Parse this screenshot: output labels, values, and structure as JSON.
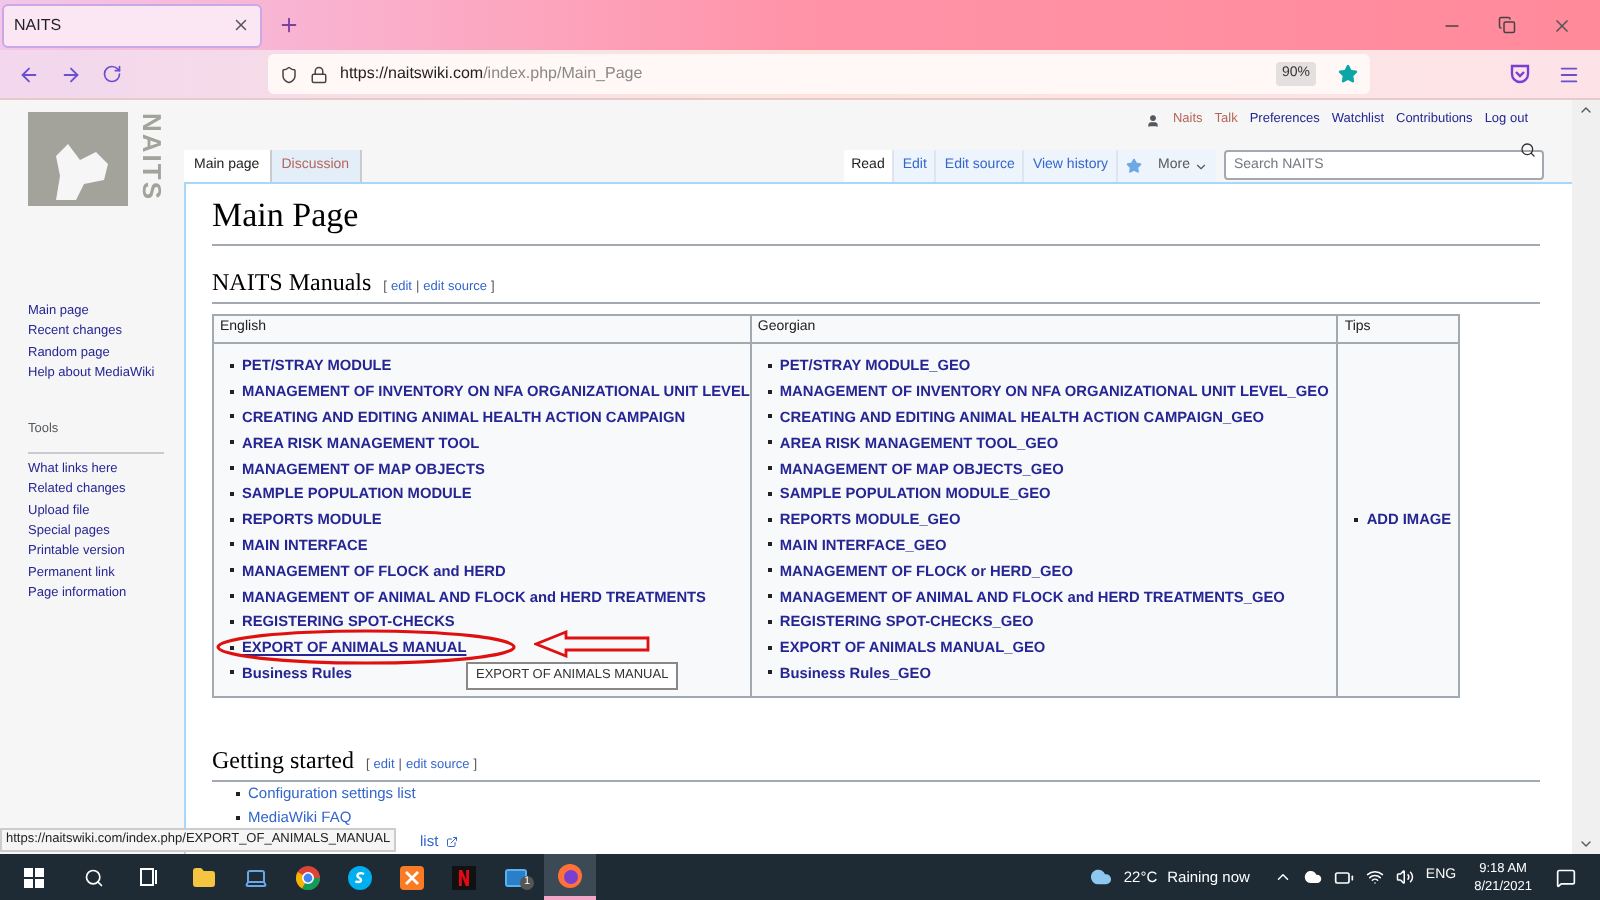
{
  "browser": {
    "tab_title": "NAITS",
    "url_host": "https://naitswiki.com",
    "url_path": "/index.php/Main_Page",
    "zoom": "90%"
  },
  "logo_text": "NAITS",
  "personal_links": [
    {
      "label": "Naits",
      "missing": true
    },
    {
      "label": "Talk",
      "missing": true
    },
    {
      "label": "Preferences",
      "missing": false
    },
    {
      "label": "Watchlist",
      "missing": false
    },
    {
      "label": "Contributions",
      "missing": false
    },
    {
      "label": "Log out",
      "missing": false
    }
  ],
  "namespace_tabs": [
    {
      "label": "Main page",
      "selected": true,
      "missing": false
    },
    {
      "label": "Discussion",
      "selected": false,
      "missing": true
    }
  ],
  "view_tabs": [
    {
      "label": "Read",
      "selected": true
    },
    {
      "label": "Edit",
      "selected": false
    },
    {
      "label": "Edit source",
      "selected": false
    },
    {
      "label": "View history",
      "selected": false
    }
  ],
  "more_menu": "More",
  "search": {
    "placeholder": "Search NAITS"
  },
  "sidebar": {
    "navigation": [
      "Main page",
      "Recent changes",
      "Random page",
      "Help about MediaWiki"
    ],
    "tools_heading": "Tools",
    "tools": [
      "What links here",
      "Related changes",
      "Upload file",
      "Special pages",
      "Printable version",
      "Permanent link",
      "Page information"
    ]
  },
  "page_title": "Main Page",
  "manuals_section": {
    "title": "NAITS Manuals",
    "edit_links": {
      "open": "[",
      "links": [
        "edit",
        "edit source"
      ],
      "separator": "|",
      "close": "]"
    },
    "table": {
      "columns": [
        "English",
        "Georgian",
        "Tips"
      ],
      "english": [
        {
          "label": "PET/STRAY MODULE",
          "hovered": false
        },
        {
          "label": "MANAGEMENT OF INVENTORY ON NFA ORGANIZATIONAL UNIT LEVEL",
          "hovered": false
        },
        {
          "label": "CREATING AND EDITING ANIMAL HEALTH ACTION CAMPAIGN",
          "hovered": false
        },
        {
          "label": "AREA RISK MANAGEMENT TOOL",
          "hovered": false
        },
        {
          "label": "MANAGEMENT OF MAP OBJECTS",
          "hovered": false
        },
        {
          "label": "SAMPLE POPULATION MODULE",
          "hovered": false
        },
        {
          "label": "REPORTS MODULE",
          "hovered": false
        },
        {
          "label": "MAIN INTERFACE",
          "hovered": false
        },
        {
          "label": "MANAGEMENT OF FLOCK and HERD",
          "hovered": false
        },
        {
          "label": "MANAGEMENT OF ANIMAL AND FLOCK and HERD TREATMENTS",
          "hovered": false
        },
        {
          "label": "REGISTERING SPOT-CHECKS",
          "hovered": false
        },
        {
          "label": "EXPORT OF ANIMALS MANUAL",
          "hovered": true,
          "tooltip": "EXPORT OF ANIMALS MANUAL"
        },
        {
          "label": "Business Rules",
          "hovered": false
        }
      ],
      "georgian": [
        "PET/STRAY MODULE_GEO",
        "MANAGEMENT OF INVENTORY ON NFA ORGANIZATIONAL UNIT LEVEL_GEO",
        "CREATING AND EDITING ANIMAL HEALTH ACTION CAMPAIGN_GEO",
        "AREA RISK MANAGEMENT TOOL_GEO",
        "MANAGEMENT OF MAP OBJECTS_GEO",
        "SAMPLE POPULATION MODULE_GEO",
        "REPORTS MODULE_GEO",
        "MAIN INTERFACE_GEO",
        "MANAGEMENT OF FLOCK or HERD_GEO",
        "MANAGEMENT OF ANIMAL AND FLOCK and HERD TREATMENTS_GEO",
        "REGISTERING SPOT-CHECKS_GEO",
        "EXPORT OF ANIMALS MANUAL_GEO",
        "Business Rules_GEO"
      ],
      "tips": [
        "ADD IMAGE"
      ]
    }
  },
  "getting_started": {
    "title": "Getting started",
    "edit_links": {
      "open": "[",
      "links": [
        "edit",
        "edit source"
      ],
      "separator": "|",
      "close": "]"
    },
    "items": [
      "Configuration settings list",
      "MediaWiki FAQ",
      "list"
    ]
  },
  "status_url": "https://naitswiki.com/index.php/EXPORT_OF_ANIMALS_MANUAL",
  "taskbar": {
    "mail_badge": "1",
    "weather_temp": "22°C",
    "weather_text": "Raining now",
    "language": "ENG",
    "time": "9:18 AM",
    "date": "8/21/2021"
  }
}
